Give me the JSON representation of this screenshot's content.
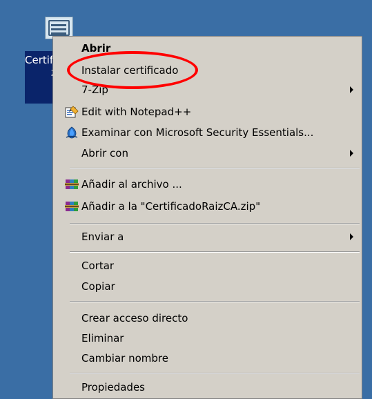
{
  "desktop_icon": {
    "label_line1": "Certifi",
    "label_line2": "z"
  },
  "context_menu": {
    "items": [
      {
        "label": "Abrir"
      },
      {
        "label": "Instalar certificado"
      },
      {
        "label": "7-Zip"
      },
      {
        "label": "Edit with Notepad++",
        "icon": "notepadpp-icon"
      },
      {
        "label": "Examinar con Microsoft Security Essentials...",
        "icon": "security-essentials-icon"
      },
      {
        "label": "Abrir con"
      },
      {
        "label": "Añadir al archivo ...",
        "icon": "winrar-icon"
      },
      {
        "label": "Añadir a la \"CertificadoRaizCA.zip\"",
        "icon": "winrar-icon"
      },
      {
        "label": "Enviar a"
      },
      {
        "label": "Cortar"
      },
      {
        "label": "Copiar"
      },
      {
        "label": "Crear acceso directo"
      },
      {
        "label": "Eliminar"
      },
      {
        "label": "Cambiar nombre"
      },
      {
        "label": "Propiedades"
      }
    ]
  },
  "colors": {
    "desktop": "#3a6ea5",
    "menu_bg": "#d4d0c8",
    "selection": "#0a246a",
    "highlight": "#ff0000"
  }
}
